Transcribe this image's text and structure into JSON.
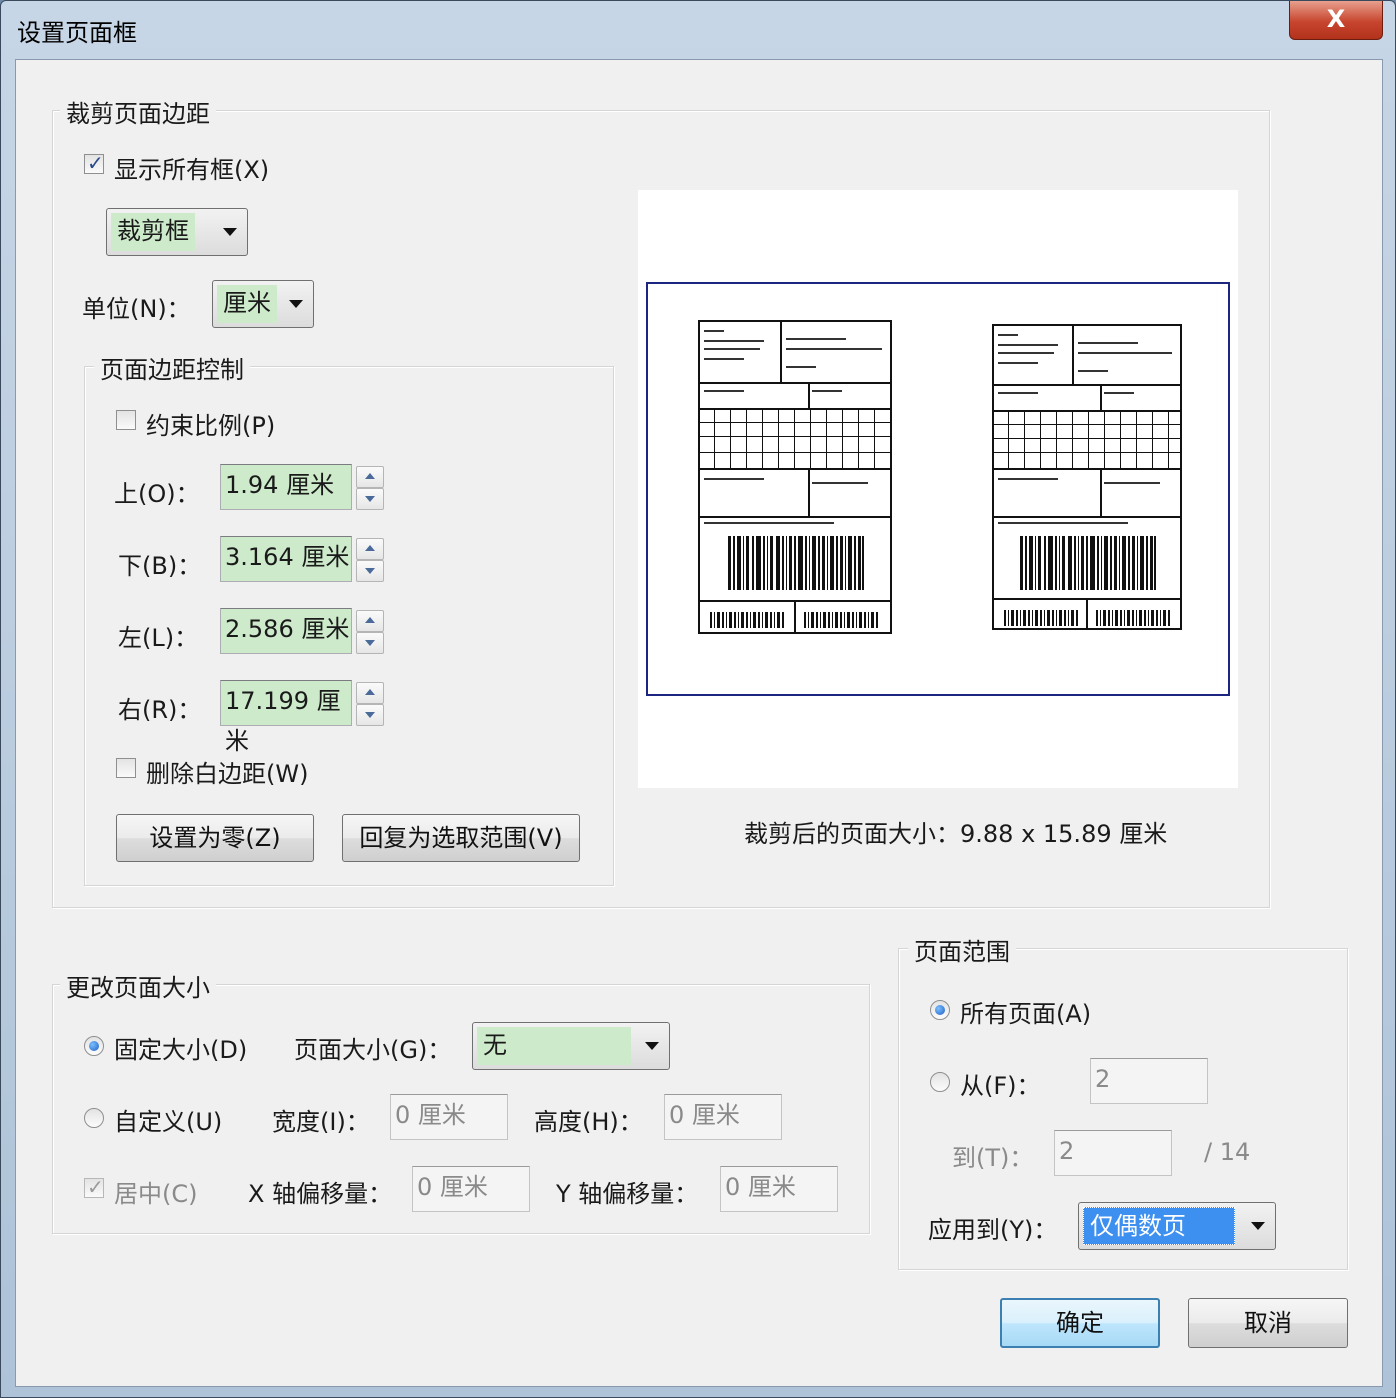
{
  "window": {
    "title": "设置页面框",
    "close_label": "X"
  },
  "crop": {
    "group_title": "裁剪页面边距",
    "show_all_boxes_label": "显示所有框(X)",
    "box_type": "裁剪框",
    "unit_label": "单位(N)：",
    "unit_value": "厘米",
    "margin_control_title": "页面边距控制",
    "constrain_label": "约束比例(P)",
    "margins": [
      {
        "label": "上(O)：",
        "value": "1.94 厘米"
      },
      {
        "label": "下(B)：",
        "value": "3.164 厘米"
      },
      {
        "label": "左(L)：",
        "value": "2.586 厘米"
      },
      {
        "label": "右(R)：",
        "value": "17.199 厘米"
      }
    ],
    "remove_white_label": "删除白边距(W)",
    "set_zero_label": "设置为零(Z)",
    "revert_label": "回复为选取范围(V)",
    "cropped_size_text": "裁剪后的页面大小：9.88 x 15.89 厘米"
  },
  "resize": {
    "group_title": "更改页面大小",
    "fixed_label": "固定大小(D)",
    "page_size_label": "页面大小(G)：",
    "page_size_value": "无",
    "custom_label": "自定义(U)",
    "width_label": "宽度(I)：",
    "width_value": "0 厘米",
    "height_label": "高度(H)：",
    "height_value": "0 厘米",
    "center_label": "居中(C)",
    "x_offset_label": "X 轴偏移量：",
    "x_offset_value": "0 厘米",
    "y_offset_label": "Y 轴偏移量：",
    "y_offset_value": "0 厘米"
  },
  "page_range": {
    "group_title": "页面范围",
    "all_pages_label": "所有页面(A)",
    "from_label": "从(F)：",
    "from_value": "2",
    "to_label": "到(T)：",
    "to_value": "2",
    "total_text": "/ 14",
    "apply_to_label": "应用到(Y)：",
    "apply_to_value": "仅偶数页"
  },
  "buttons": {
    "ok": "确定",
    "cancel": "取消"
  }
}
